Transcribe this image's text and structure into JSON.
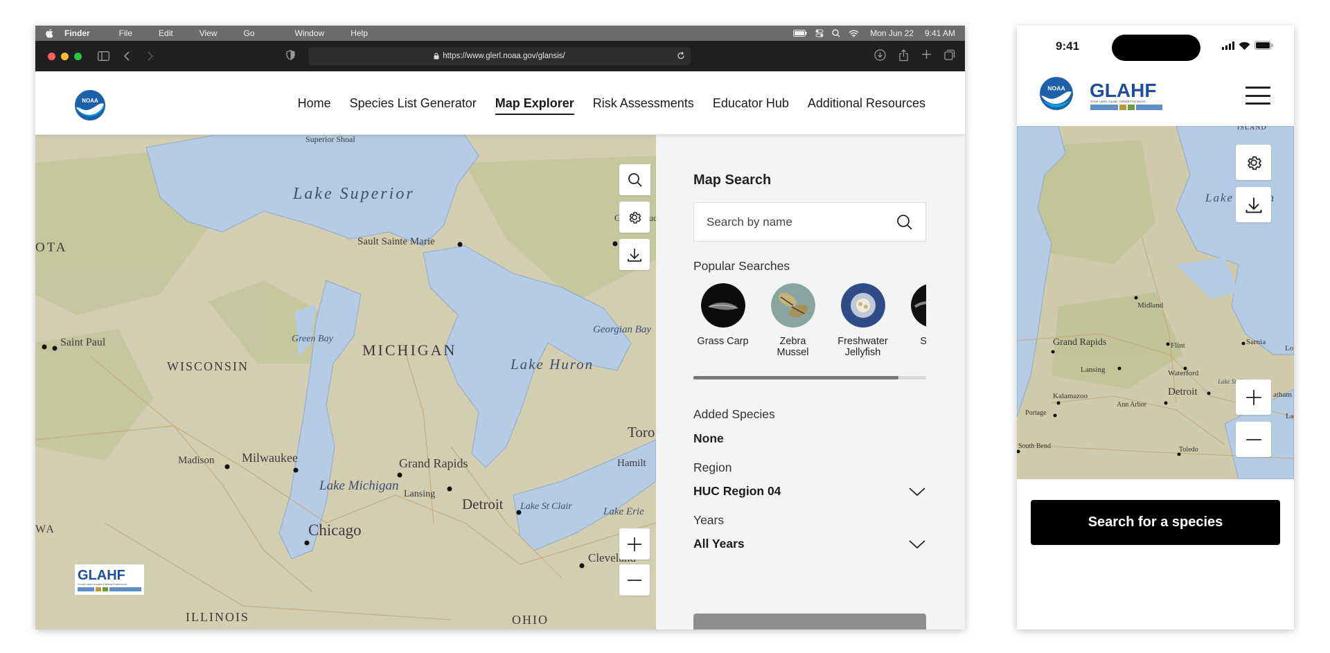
{
  "desktop": {
    "menubar": {
      "items": [
        "Finder",
        "File",
        "Edit",
        "View",
        "Go",
        "Window",
        "Help"
      ],
      "date": "Mon Jun 22",
      "time": "9:41 AM"
    },
    "browser": {
      "url": "https://www.glerl.noaa.gov/glansis/"
    },
    "header": {
      "logo_text": "NOAA",
      "nav": [
        {
          "label": "Home",
          "active": false
        },
        {
          "label": "Species List Generator",
          "active": false
        },
        {
          "label": "Map Explorer",
          "active": true
        },
        {
          "label": "Risk Assessments",
          "active": false
        },
        {
          "label": "Educator Hub",
          "active": false
        },
        {
          "label": "Additional Resources",
          "active": false
        }
      ]
    },
    "map": {
      "labels": {
        "superior_shoal": "Superior Shoal",
        "lake_superior": "Lake Superior",
        "sault": "Sault Sainte Marie",
        "sudbury": "Greater Sudbury",
        "ota": "OTA",
        "saint_paul": "Saint Paul",
        "wisconsin": "WISCONSIN",
        "green_bay": "Green Bay",
        "michigan": "MICHIGAN",
        "georgian_bay": "Georgian Bay",
        "lake_huron": "Lake Huron",
        "toronto": "Toro",
        "hamilton": "Hamilt",
        "madison": "Madison",
        "milwaukee": "Milwaukee",
        "lake_michigan": "Lake Michigan",
        "grand_rapids": "Grand Rapids",
        "lansing": "Lansing",
        "detroit": "Detroit",
        "lake_st_clair": "Lake St Clair",
        "lake_erie": "Lake Erie",
        "cleveland": "Cleveland",
        "chicago": "Chicago",
        "iowa": "WA",
        "illinois": "ILLINOIS",
        "ohio": "OHIO"
      },
      "logo_text": "GLAHF",
      "logo_sub": "Great Lakes Aquatic Habitat Framework"
    },
    "panel": {
      "title": "Map Search",
      "search_placeholder": "Search by name",
      "popular_label": "Popular Searches",
      "popular": [
        {
          "name": "Grass Carp"
        },
        {
          "name": "Zebra Mussel"
        },
        {
          "name": "Freshwater Jellyfish"
        },
        {
          "name": "Silver"
        }
      ],
      "scroll_progress": 0.88,
      "added_label": "Added Species",
      "added_value": "None",
      "region_label": "Region",
      "region_value": "HUC Region 04",
      "years_label": "Years",
      "years_value": "All Years"
    }
  },
  "phone": {
    "time": "9:41",
    "logo_text": "NOAA",
    "glahf_text": "GLAHF",
    "glahf_sub": "Great Lakes Aquatic Habitat Framework",
    "map": {
      "labels": {
        "lake_huron": "Lake Huron",
        "midland": "Midland",
        "grand_rapids": "Grand Rapids",
        "flint": "Flint",
        "sarnia": "Sarnia",
        "lansing": "Lansing",
        "waterford": "Waterford",
        "detroit": "Detroit",
        "kalamazoo": "Kalamazoo",
        "ann_arbor": "Ann Arbor",
        "portage": "Portage",
        "chatham": "atham",
        "south_bend": "South Bend",
        "toledo": "Toledo",
        "lo": "Lo",
        "la": "La",
        "island": "ISLAND",
        "lake_st_clair": "Lake St Clair"
      }
    },
    "cta": "Search for a species"
  }
}
